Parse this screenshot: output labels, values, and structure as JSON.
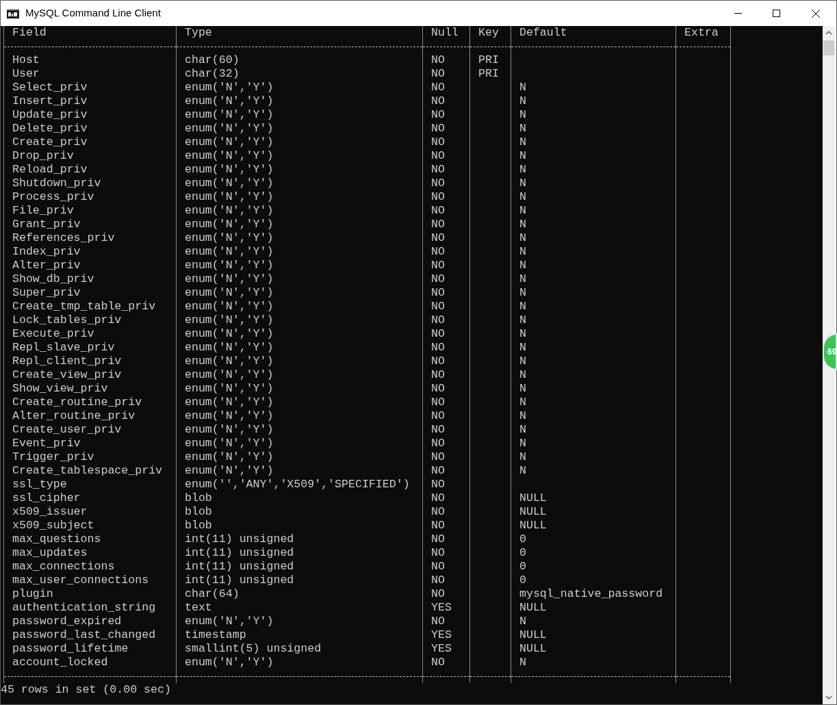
{
  "window": {
    "title": "MySQL Command Line Client"
  },
  "table": {
    "columns": [
      "Field",
      "Type",
      "Null",
      "Key",
      "Default",
      "Extra"
    ],
    "rows": [
      {
        "field": "Host",
        "type": "char(60)",
        "null": "NO",
        "key": "PRI"
      },
      {
        "field": "User",
        "type": "char(32)",
        "null": "NO",
        "key": "PRI"
      },
      {
        "field": "Select_priv",
        "type": "enum('N','Y')",
        "null": "NO",
        "default": "N"
      },
      {
        "field": "Insert_priv",
        "type": "enum('N','Y')",
        "null": "NO",
        "default": "N"
      },
      {
        "field": "Update_priv",
        "type": "enum('N','Y')",
        "null": "NO",
        "default": "N"
      },
      {
        "field": "Delete_priv",
        "type": "enum('N','Y')",
        "null": "NO",
        "default": "N"
      },
      {
        "field": "Create_priv",
        "type": "enum('N','Y')",
        "null": "NO",
        "default": "N"
      },
      {
        "field": "Drop_priv",
        "type": "enum('N','Y')",
        "null": "NO",
        "default": "N"
      },
      {
        "field": "Reload_priv",
        "type": "enum('N','Y')",
        "null": "NO",
        "default": "N"
      },
      {
        "field": "Shutdown_priv",
        "type": "enum('N','Y')",
        "null": "NO",
        "default": "N"
      },
      {
        "field": "Process_priv",
        "type": "enum('N','Y')",
        "null": "NO",
        "default": "N"
      },
      {
        "field": "File_priv",
        "type": "enum('N','Y')",
        "null": "NO",
        "default": "N"
      },
      {
        "field": "Grant_priv",
        "type": "enum('N','Y')",
        "null": "NO",
        "default": "N"
      },
      {
        "field": "References_priv",
        "type": "enum('N','Y')",
        "null": "NO",
        "default": "N"
      },
      {
        "field": "Index_priv",
        "type": "enum('N','Y')",
        "null": "NO",
        "default": "N"
      },
      {
        "field": "Alter_priv",
        "type": "enum('N','Y')",
        "null": "NO",
        "default": "N"
      },
      {
        "field": "Show_db_priv",
        "type": "enum('N','Y')",
        "null": "NO",
        "default": "N"
      },
      {
        "field": "Super_priv",
        "type": "enum('N','Y')",
        "null": "NO",
        "default": "N"
      },
      {
        "field": "Create_tmp_table_priv",
        "type": "enum('N','Y')",
        "null": "NO",
        "default": "N"
      },
      {
        "field": "Lock_tables_priv",
        "type": "enum('N','Y')",
        "null": "NO",
        "default": "N"
      },
      {
        "field": "Execute_priv",
        "type": "enum('N','Y')",
        "null": "NO",
        "default": "N"
      },
      {
        "field": "Repl_slave_priv",
        "type": "enum('N','Y')",
        "null": "NO",
        "default": "N"
      },
      {
        "field": "Repl_client_priv",
        "type": "enum('N','Y')",
        "null": "NO",
        "default": "N"
      },
      {
        "field": "Create_view_priv",
        "type": "enum('N','Y')",
        "null": "NO",
        "default": "N"
      },
      {
        "field": "Show_view_priv",
        "type": "enum('N','Y')",
        "null": "NO",
        "default": "N"
      },
      {
        "field": "Create_routine_priv",
        "type": "enum('N','Y')",
        "null": "NO",
        "default": "N"
      },
      {
        "field": "Alter_routine_priv",
        "type": "enum('N','Y')",
        "null": "NO",
        "default": "N"
      },
      {
        "field": "Create_user_priv",
        "type": "enum('N','Y')",
        "null": "NO",
        "default": "N"
      },
      {
        "field": "Event_priv",
        "type": "enum('N','Y')",
        "null": "NO",
        "default": "N"
      },
      {
        "field": "Trigger_priv",
        "type": "enum('N','Y')",
        "null": "NO",
        "default": "N"
      },
      {
        "field": "Create_tablespace_priv",
        "type": "enum('N','Y')",
        "null": "NO",
        "default": "N"
      },
      {
        "field": "ssl_type",
        "type": "enum('','ANY','X509','SPECIFIED')",
        "null": "NO"
      },
      {
        "field": "ssl_cipher",
        "type": "blob",
        "null": "NO",
        "default": "NULL"
      },
      {
        "field": "x509_issuer",
        "type": "blob",
        "null": "NO",
        "default": "NULL"
      },
      {
        "field": "x509_subject",
        "type": "blob",
        "null": "NO",
        "default": "NULL"
      },
      {
        "field": "max_questions",
        "type": "int(11) unsigned",
        "null": "NO",
        "default": "0"
      },
      {
        "field": "max_updates",
        "type": "int(11) unsigned",
        "null": "NO",
        "default": "0"
      },
      {
        "field": "max_connections",
        "type": "int(11) unsigned",
        "null": "NO",
        "default": "0"
      },
      {
        "field": "max_user_connections",
        "type": "int(11) unsigned",
        "null": "NO",
        "default": "0"
      },
      {
        "field": "plugin",
        "type": "char(64)",
        "null": "NO",
        "default": "mysql_native_password"
      },
      {
        "field": "authentication_string",
        "type": "text",
        "null": "YES",
        "default": "NULL"
      },
      {
        "field": "password_expired",
        "type": "enum('N','Y')",
        "null": "NO",
        "default": "N"
      },
      {
        "field": "password_last_changed",
        "type": "timestamp",
        "null": "YES",
        "default": "NULL"
      },
      {
        "field": "password_lifetime",
        "type": "smallint(5) unsigned",
        "null": "YES",
        "default": "NULL"
      },
      {
        "field": "account_locked",
        "type": "enum('N','Y')",
        "null": "NO",
        "default": "N"
      }
    ]
  },
  "status_line": "45 rows in set (0.00 sec)",
  "floating_badge": {
    "text": "69"
  }
}
